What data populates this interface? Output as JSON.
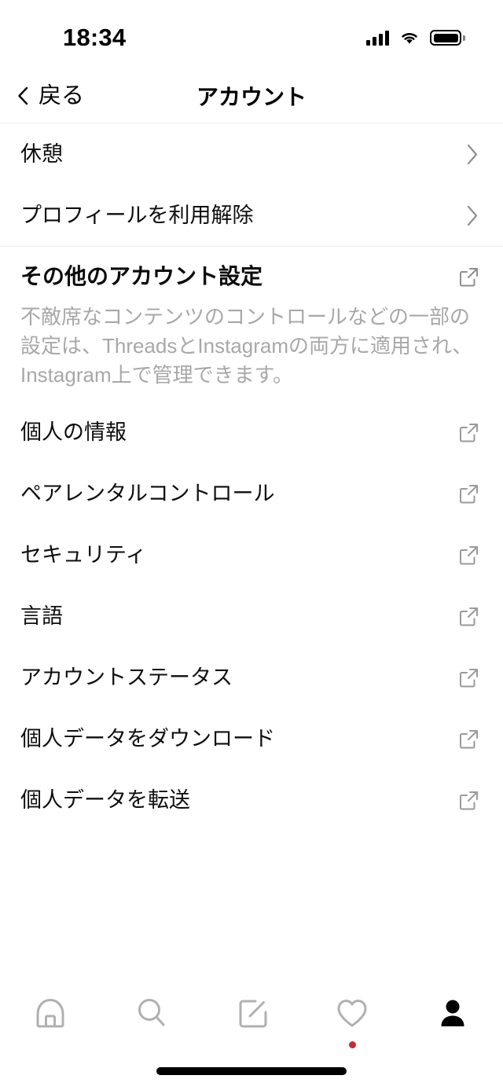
{
  "status_bar": {
    "time": "18:34",
    "signal_icon": "signal-bars-icon",
    "wifi_icon": "wifi-icon",
    "battery_icon": "battery-full-icon"
  },
  "nav": {
    "back_label": "戻る",
    "back_icon": "chevron-left-icon",
    "title": "アカウント"
  },
  "chevron_rows": [
    {
      "label": "休憩",
      "icon": "chevron-right-icon"
    },
    {
      "label": "プロフィールを利用解除",
      "icon": "chevron-right-icon"
    }
  ],
  "section": {
    "title": "その他のアカウント設定",
    "icon": "external-link-icon",
    "description": "不敵席なコンテンツのコントロールなどの一部の設定は、ThreadsとInstagramの両方に適用され、Instagram上で管理できます。"
  },
  "external_rows": [
    {
      "label": "個人の情報",
      "icon": "external-link-icon"
    },
    {
      "label": "ペアレンタルコントロール",
      "icon": "external-link-icon"
    },
    {
      "label": "セキュリティ",
      "icon": "external-link-icon"
    },
    {
      "label": "言語",
      "icon": "external-link-icon"
    },
    {
      "label": "アカウントステータス",
      "icon": "external-link-icon"
    },
    {
      "label": "個人データをダウンロード",
      "icon": "external-link-icon"
    },
    {
      "label": "個人データを転送",
      "icon": "external-link-icon"
    }
  ],
  "tab_bar": {
    "tabs": [
      {
        "name": "home",
        "icon": "home-icon",
        "active": false
      },
      {
        "name": "search",
        "icon": "search-icon",
        "active": false
      },
      {
        "name": "compose",
        "icon": "compose-icon",
        "active": false
      },
      {
        "name": "activity",
        "icon": "heart-icon",
        "active": false,
        "badge": true
      },
      {
        "name": "profile",
        "icon": "person-icon",
        "active": true
      }
    ]
  },
  "colors": {
    "text_primary": "#0e0e0e",
    "text_muted": "#a8a8a8",
    "icon_inactive": "#b0b0b0",
    "icon_active": "#000000",
    "divider": "#ededed",
    "badge": "#c02c38"
  }
}
